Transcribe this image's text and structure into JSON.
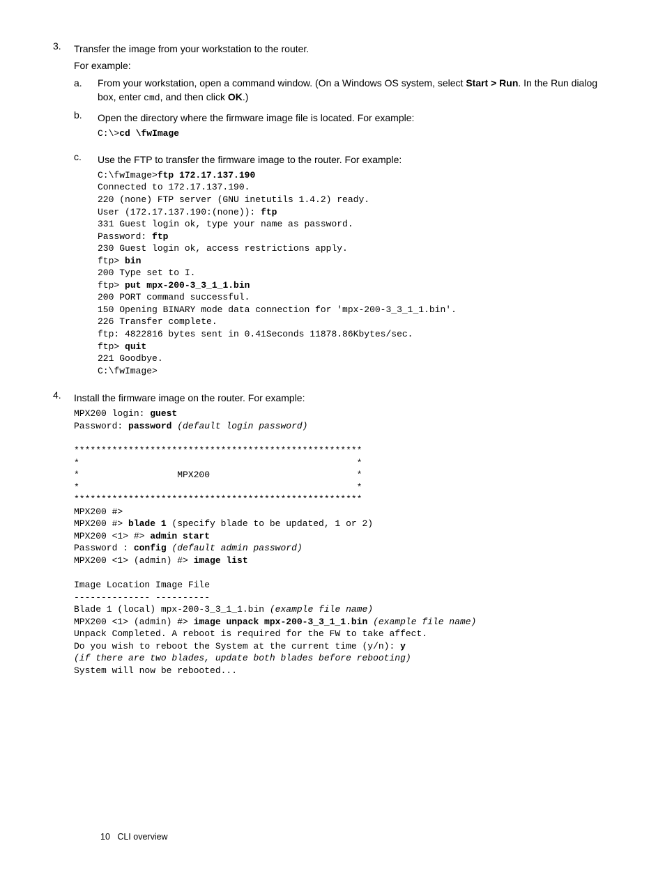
{
  "step3": {
    "num": "3.",
    "text": "Transfer the image from your workstation to the router.",
    "eg": "For example:",
    "a": {
      "let": "a.",
      "pre": "From your workstation, open a command window. (On a Windows OS system, select ",
      "b1": "Start > Run",
      "mid": ". In the Run dialog box, enter ",
      "cmd": "cmd",
      "mid2": ", and then click ",
      "b2": "OK",
      "end": ".)"
    },
    "b": {
      "let": "b.",
      "text": "Open the directory where the firmware image file is located. For example:",
      "code_p": "C:\\>",
      "code_b": "cd \\fwImage"
    },
    "c": {
      "let": "c.",
      "text": "Use the FTP to transfer the firmware image to the router. For example:",
      "l1a": "C:\\fwImage>",
      "l1b": "ftp 172.17.137.190",
      "l2": "Connected to 172.17.137.190.",
      "l3": "220 (none) FTP server (GNU inetutils 1.4.2) ready.",
      "l4a": "User (172.17.137.190:(none)): ",
      "l4b": "ftp",
      "l5": "331 Guest login ok, type your name as password.",
      "l6a": "Password: ",
      "l6b": "ftp",
      "l7": "230 Guest login ok, access restrictions apply.",
      "l8a": "ftp> ",
      "l8b": "bin",
      "l9": "200 Type set to I.",
      "l10a": "ftp> ",
      "l10b": "put mpx-200-3_3_1_1.bin",
      "l11": "200 PORT command successful.",
      "l12": "150 Opening BINARY mode data connection for 'mpx-200-3_3_1_1.bin'.",
      "l13": "226 Transfer complete.",
      "l14": "ftp: 4822816 bytes sent in 0.41Seconds 11878.86Kbytes/sec.",
      "l15a": "ftp> ",
      "l15b": "quit",
      "l16": "221 Goodbye.",
      "l17": "C:\\fwImage>"
    }
  },
  "step4": {
    "num": "4.",
    "text": "Install the firmware image on the router. For example:",
    "l1a": "MPX200 login: ",
    "l1b": "guest",
    "l2a": "Password: ",
    "l2b": "password",
    "l2c": " (default login password)",
    "blank1": "",
    "l3": "*****************************************************",
    "l4": "*                                                   *",
    "l5": "*                  MPX200                           *",
    "l6": "*                                                   *",
    "l7": "*****************************************************",
    "l8": "MPX200 #>",
    "l9a": "MPX200 #> ",
    "l9b": "blade 1",
    "l9c": " (specify blade to be updated, 1 or 2)",
    "l10a": "MPX200 <1> #> ",
    "l10b": "admin start",
    "l11a": "Password : ",
    "l11b": "config",
    "l11c": " (default admin password)",
    "l12a": "MPX200 <1> (admin) #> ",
    "l12b": "image list",
    "blank2": "",
    "l13": "Image Location Image File",
    "l14": "-------------- ----------",
    "l15a": "Blade 1 (local) mpx-200-3_3_1_1.bin ",
    "l15b": "(example file name)",
    "l16a": "MPX200 <1> (admin) #> ",
    "l16b": "image unpack mpx-200-3_3_1_1.bin",
    "l16c": " (example file name)",
    "l17": "Unpack Completed. A reboot is required for the FW to take affect.",
    "l18a": "Do you wish to reboot the System at the current time (y/n): ",
    "l18b": "y",
    "l19": "(if there are two blades, update both blades before rebooting)",
    "l20": "System will now be rebooted..."
  },
  "footer": {
    "page": "10",
    "title": "CLI overview"
  }
}
